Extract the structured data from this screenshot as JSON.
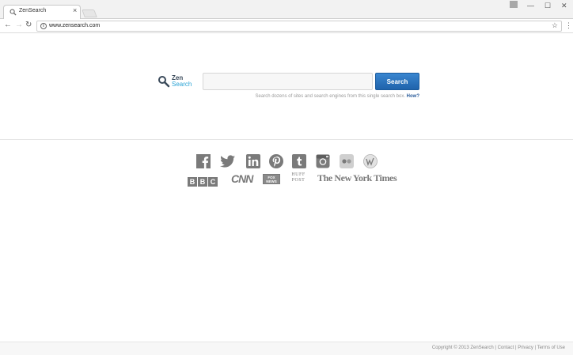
{
  "browser": {
    "tab_title": "ZenSearch",
    "tab_close": "×",
    "url": "www.zensearch.com",
    "info": "i",
    "star": "☆",
    "menu": "⋮",
    "back": "←",
    "forward": "→",
    "reload": "↻",
    "minimize": "—",
    "maximize": "☐",
    "close": "✕"
  },
  "logo": {
    "line1": "Zen",
    "line2": "Search"
  },
  "search": {
    "value": "",
    "placeholder": "",
    "button_label": "Search",
    "tagline": "Search dozens of sites and search engines from this single search box.",
    "how_label": "How?"
  },
  "social_icons": [
    "facebook-icon",
    "twitter-icon",
    "linkedin-icon",
    "pinterest-icon",
    "tumblr-icon",
    "instagram-icon",
    "flickr-icon",
    "wikipedia-icon"
  ],
  "news": {
    "bbc": "BBC",
    "cnn": "CNN",
    "fox": "FOX NEWS",
    "huff": "HUFF POST",
    "nyt": "The New York Times"
  },
  "footer": {
    "copyright": "Copyright © 2013 ZenSearch",
    "sep": " | ",
    "contact": "Contact",
    "privacy": "Privacy",
    "terms": "Terms of Use"
  },
  "colors": {
    "accent": "#2aa3d5",
    "button": "#1f63ab",
    "icon_gray": "#7a7a7a"
  }
}
